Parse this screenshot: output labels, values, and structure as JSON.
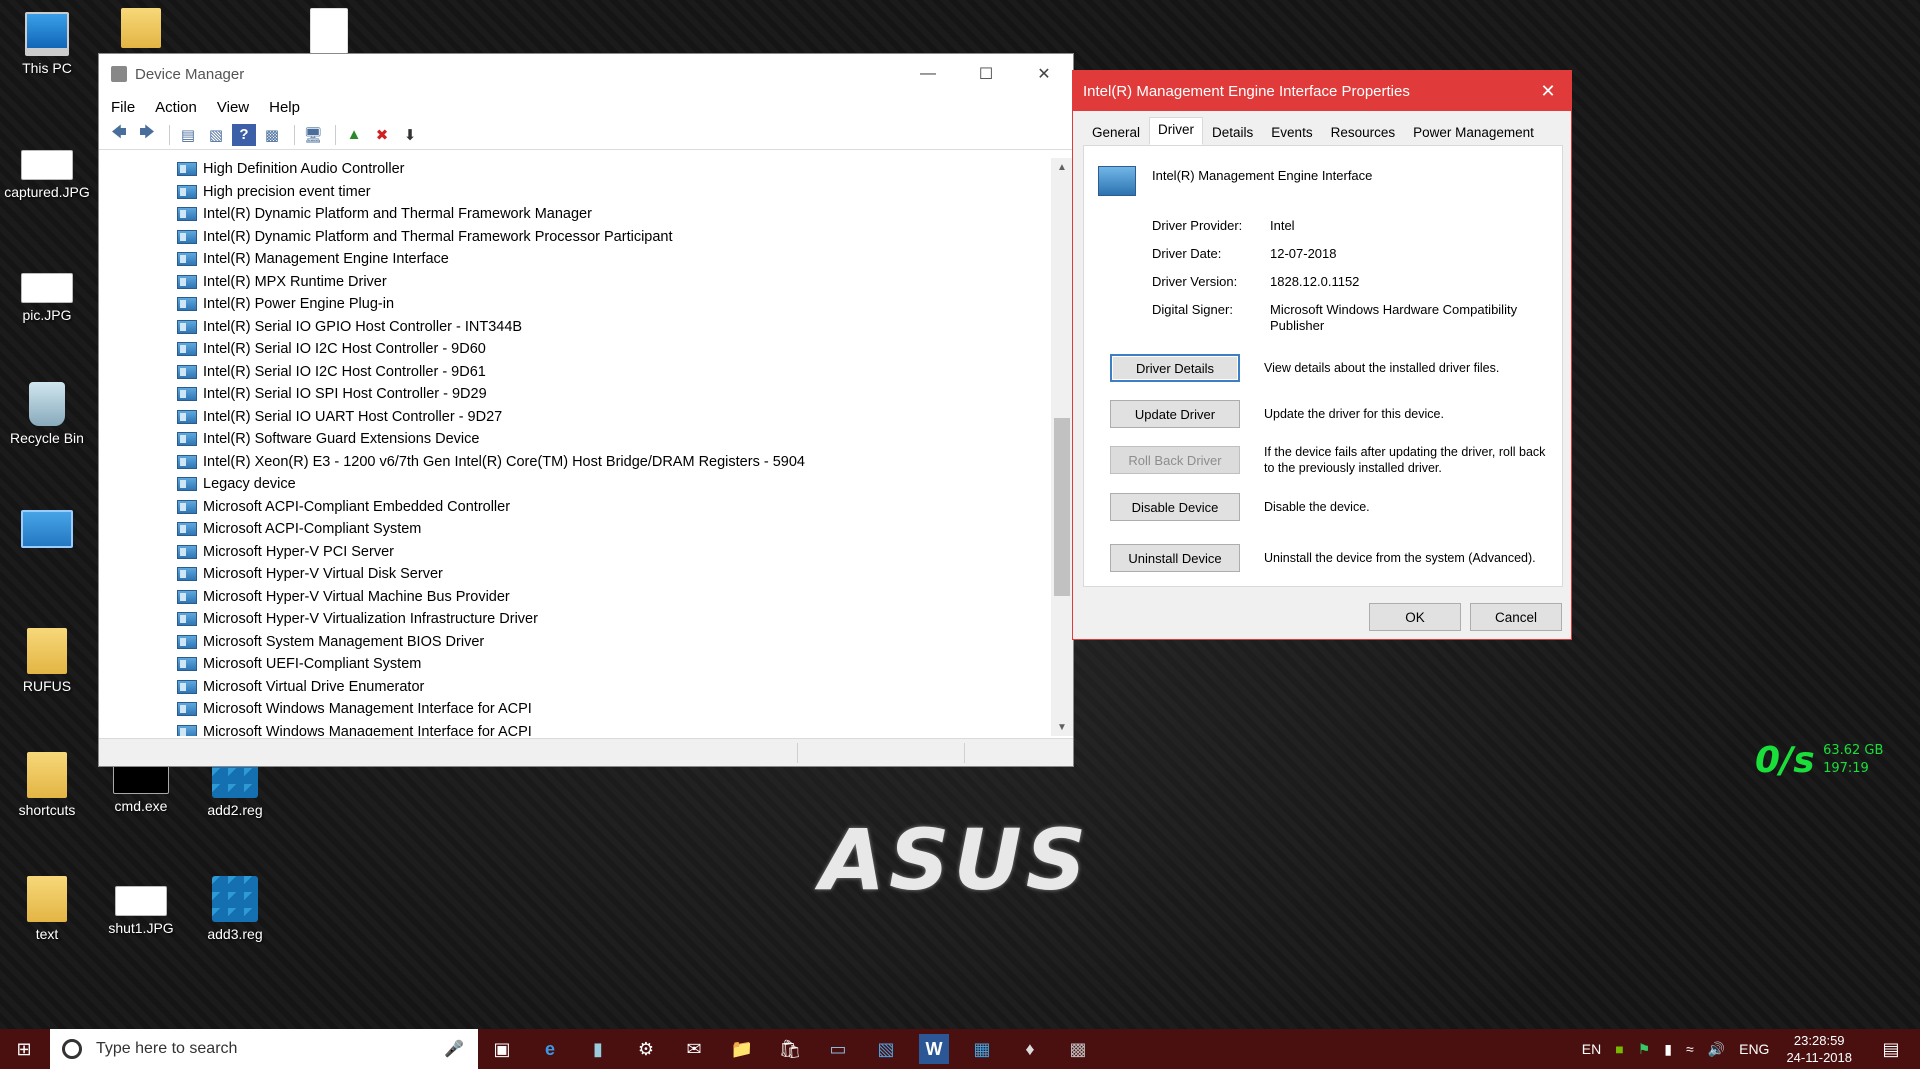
{
  "desktop": {
    "icons": [
      {
        "label": "This PC",
        "icon": "this-pc-icon"
      },
      {
        "label": "captured.JPG",
        "icon": "image-file-icon"
      },
      {
        "label": "pic.JPG",
        "icon": "image-file-icon"
      },
      {
        "label": "Recycle Bin",
        "icon": "recycle-bin-icon"
      },
      {
        "label": "RUFUS",
        "icon": "folder-icon"
      },
      {
        "label": "shortcuts",
        "icon": "folder-icon"
      },
      {
        "label": "cmd.exe",
        "icon": "cmd-icon"
      },
      {
        "label": "add2.reg",
        "icon": "registry-file-icon"
      },
      {
        "label": "text",
        "icon": "folder-icon"
      },
      {
        "label": "shut1.JPG",
        "icon": "image-file-icon"
      },
      {
        "label": "add3.reg",
        "icon": "registry-file-icon"
      }
    ],
    "wallpaper_logo": "ASUS"
  },
  "device_manager": {
    "title": "Device Manager",
    "menu": [
      "File",
      "Action",
      "View",
      "Help"
    ],
    "items": [
      "High Definition Audio Controller",
      "High precision event timer",
      "Intel(R) Dynamic Platform and Thermal Framework Manager",
      "Intel(R) Dynamic Platform and Thermal Framework Processor Participant",
      "Intel(R) Management Engine Interface",
      "Intel(R) MPX Runtime Driver",
      "Intel(R) Power Engine Plug-in",
      "Intel(R) Serial IO GPIO Host Controller - INT344B",
      "Intel(R) Serial IO I2C Host Controller - 9D60",
      "Intel(R) Serial IO I2C Host Controller - 9D61",
      "Intel(R) Serial IO SPI Host Controller - 9D29",
      "Intel(R) Serial IO UART Host Controller - 9D27",
      "Intel(R) Software Guard Extensions Device",
      "Intel(R) Xeon(R) E3 - 1200 v6/7th Gen Intel(R) Core(TM) Host Bridge/DRAM Registers - 5904",
      "Legacy device",
      "Microsoft ACPI-Compliant Embedded Controller",
      "Microsoft ACPI-Compliant System",
      "Microsoft Hyper-V PCI Server",
      "Microsoft Hyper-V Virtual Disk Server",
      "Microsoft Hyper-V Virtual Machine Bus Provider",
      "Microsoft Hyper-V Virtualization Infrastructure Driver",
      "Microsoft System Management BIOS Driver",
      "Microsoft UEFI-Compliant System",
      "Microsoft Virtual Drive Enumerator",
      "Microsoft Windows Management Interface for ACPI",
      "Microsoft Windows Management Interface for ACPI"
    ]
  },
  "properties": {
    "title": "Intel(R) Management Engine Interface  Properties",
    "tabs": [
      "General",
      "Driver",
      "Details",
      "Events",
      "Resources",
      "Power Management"
    ],
    "active_tab": "Driver",
    "device_name": "Intel(R) Management Engine Interface",
    "fields": [
      {
        "key": "Driver Provider:",
        "value": "Intel"
      },
      {
        "key": "Driver Date:",
        "value": "12-07-2018"
      },
      {
        "key": "Driver Version:",
        "value": "1828.12.0.1152"
      },
      {
        "key": "Digital Signer:",
        "value": "Microsoft Windows Hardware Compatibility Publisher"
      }
    ],
    "actions": [
      {
        "label": "Driver Details",
        "desc": "View details about the installed driver files."
      },
      {
        "label": "Update Driver",
        "desc": "Update the driver for this device."
      },
      {
        "label": "Roll Back Driver",
        "desc": "If the device fails after updating the driver, roll back to the previously installed driver."
      },
      {
        "label": "Disable Device",
        "desc": "Disable the device."
      },
      {
        "label": "Uninstall Device",
        "desc": "Uninstall the device from the system (Advanced)."
      }
    ],
    "ok_label": "OK",
    "cancel_label": "Cancel"
  },
  "netmeter": {
    "speed": "0/s",
    "total": "63.62 GB",
    "time": "197:19",
    "color": "#1adf3a"
  },
  "taskbar": {
    "search_placeholder": "Type here to search",
    "lang_short": "EN",
    "lang": "ENG",
    "time": "23:28:59",
    "date": "24-11-2018",
    "color": "#4a0f0f"
  }
}
